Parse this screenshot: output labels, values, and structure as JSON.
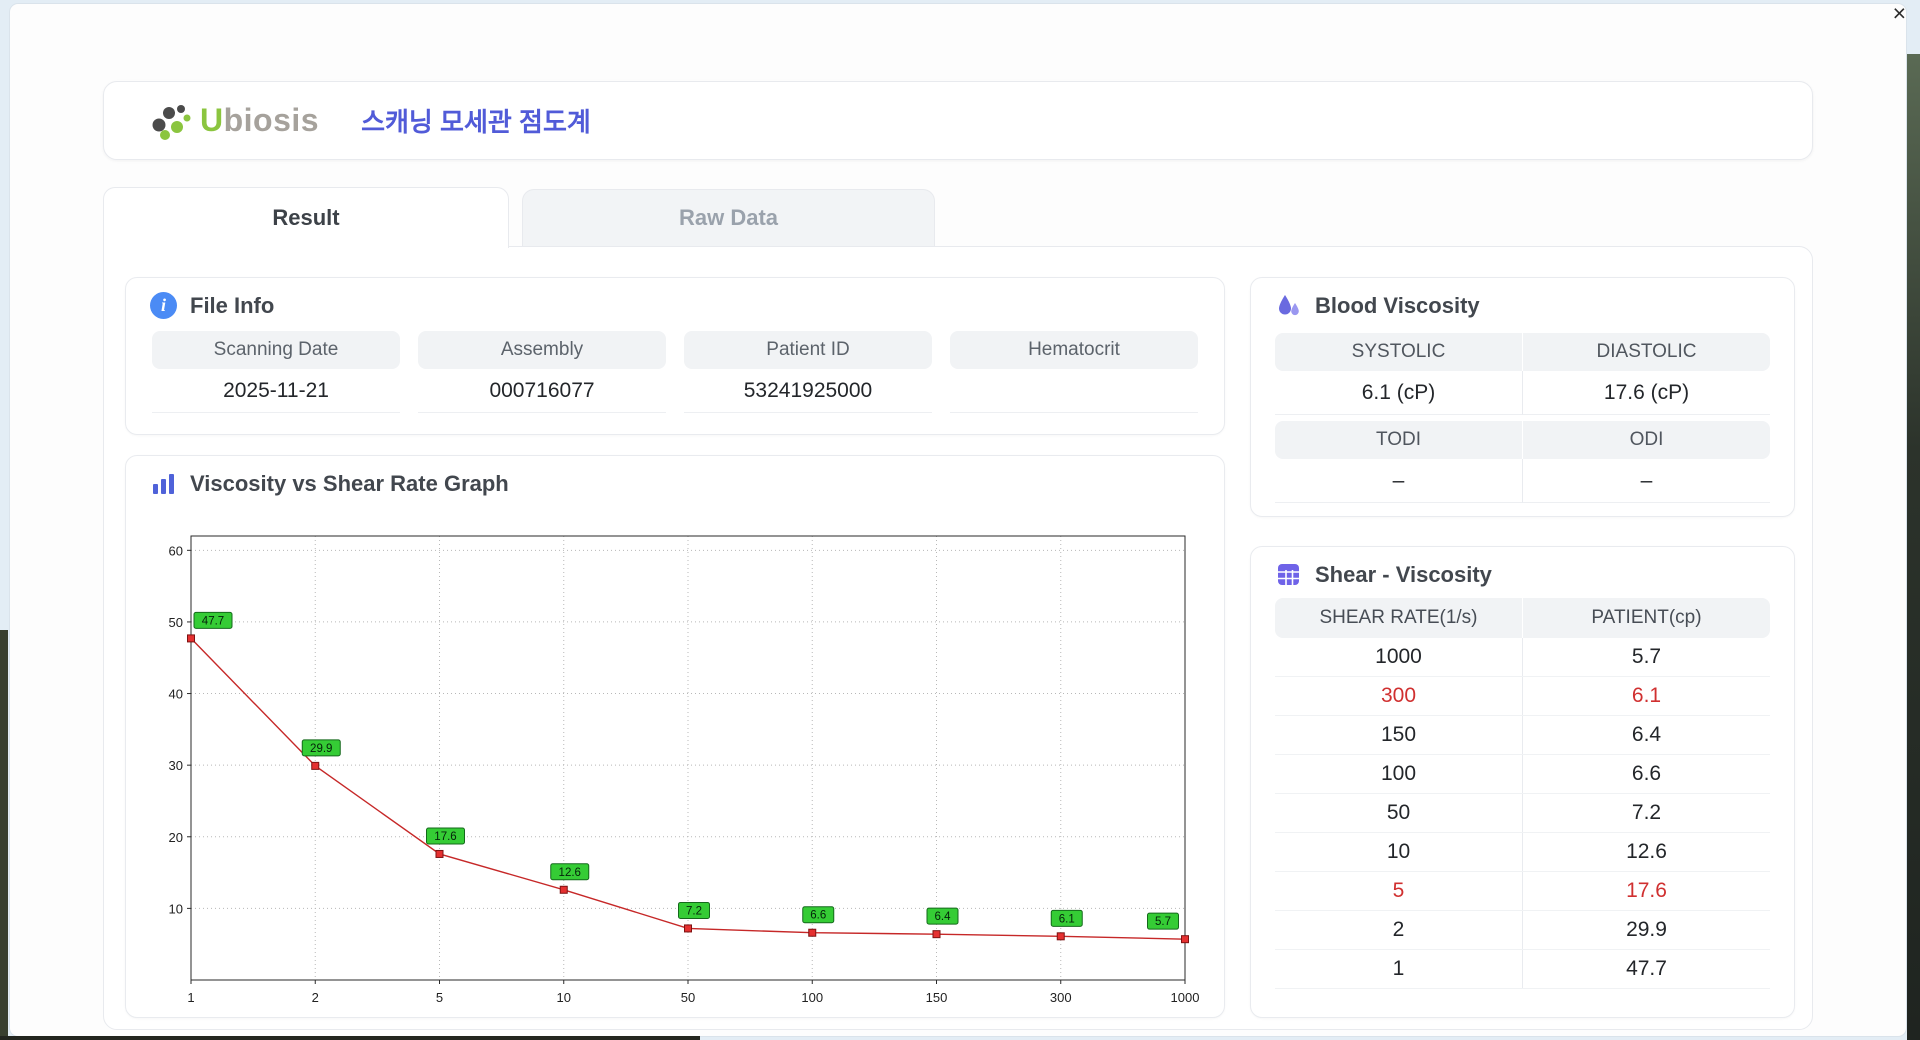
{
  "window": {
    "close_glyph": "×"
  },
  "header": {
    "logo": "Ubiosis",
    "title": "스캐닝 모세관 점도계"
  },
  "tabs": [
    {
      "label": "Result",
      "active": true
    },
    {
      "label": "Raw Data",
      "active": false
    }
  ],
  "file_info": {
    "title": "File Info",
    "fields": [
      {
        "label": "Scanning Date",
        "value": "2025-11-21"
      },
      {
        "label": "Assembly",
        "value": "000716077"
      },
      {
        "label": "Patient ID",
        "value": "53241925000"
      },
      {
        "label": "Hematocrit",
        "value": ""
      }
    ]
  },
  "blood_viscosity": {
    "title": "Blood Viscosity",
    "rows": [
      {
        "labels": [
          "SYSTOLIC",
          "DIASTOLIC"
        ],
        "values": [
          "6.1 (cP)",
          "17.6 (cP)"
        ]
      },
      {
        "labels": [
          "TODI",
          "ODI"
        ],
        "values": [
          "–",
          "–"
        ]
      }
    ]
  },
  "chart_data": {
    "type": "line",
    "title": "Viscosity vs Shear Rate Graph",
    "x_labels": [
      "1",
      "2",
      "5",
      "10",
      "50",
      "100",
      "150",
      "300",
      "1000"
    ],
    "values": [
      47.7,
      29.9,
      17.6,
      12.6,
      7.2,
      6.6,
      6.4,
      6.1,
      5.7
    ],
    "y_ticks": [
      10,
      20,
      30,
      40,
      50,
      60
    ],
    "ylim": [
      0,
      62
    ],
    "grid": "dotted",
    "line_color": "#c62828",
    "marker_color": "#e53030",
    "label_bg": "#35cc35"
  },
  "shear_table": {
    "title": "Shear - Viscosity",
    "columns": [
      "SHEAR RATE(1/s)",
      "PATIENT(cp)"
    ],
    "rows": [
      {
        "rate": "1000",
        "value": "5.7",
        "highlight": false
      },
      {
        "rate": "300",
        "value": "6.1",
        "highlight": true
      },
      {
        "rate": "150",
        "value": "6.4",
        "highlight": false
      },
      {
        "rate": "100",
        "value": "6.6",
        "highlight": false
      },
      {
        "rate": "50",
        "value": "7.2",
        "highlight": false
      },
      {
        "rate": "10",
        "value": "12.6",
        "highlight": false
      },
      {
        "rate": "5",
        "value": "17.6",
        "highlight": true
      },
      {
        "rate": "2",
        "value": "29.9",
        "highlight": false
      },
      {
        "rate": "1",
        "value": "47.7",
        "highlight": false
      }
    ]
  },
  "colors": {
    "accent_purple": "#515bd8",
    "logo_green": "#8bc53f",
    "highlight_red": "#d03030",
    "label_bg_gray": "#f1f3f5"
  }
}
